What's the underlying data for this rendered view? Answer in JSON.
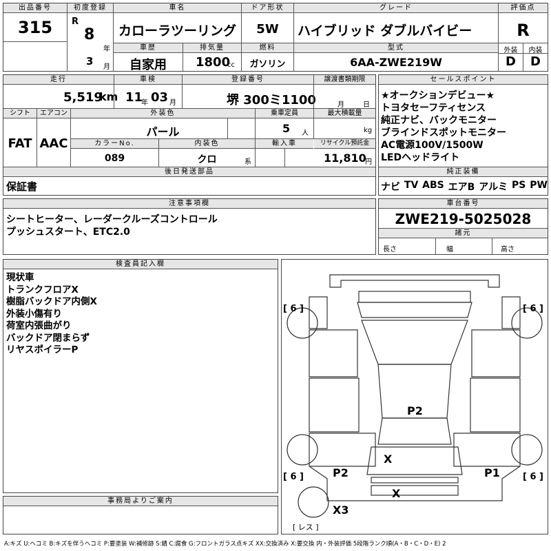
{
  "top": {
    "lot_label": "出品番号",
    "lot_no": "315",
    "first_reg_label": "初度登録",
    "era": "R",
    "year": "8",
    "year_unit": "年",
    "month": "3",
    "month_unit": "月",
    "model_label": "車名",
    "model": "カローラツーリング",
    "door_label": "ドア形状",
    "door": "5W",
    "grade_label": "グレード",
    "grade": "ハイブリッド ダブルバイビー",
    "score_label": "評価点",
    "score": "R",
    "history_label": "車歴",
    "history": "自家用",
    "disp_label": "排気量",
    "disp": "1800",
    "disp_unit": "cc",
    "fuel_label": "燃料",
    "fuel": "ガソリン",
    "type_label": "型式",
    "type": "6AA-ZWE219W",
    "ext_label": "外装",
    "ext": "D",
    "int_label": "内装",
    "int": "D"
  },
  "row2": {
    "mileage_label": "走行",
    "mileage": "5,519",
    "mileage_unit": "km",
    "inspect_label": "車検",
    "inspect_y": "11",
    "inspect_y_unit": "年",
    "inspect_m": "03",
    "inspect_m_unit": "月",
    "plate_label": "登録番号",
    "plate": "堺 300ミ1100",
    "transfer_label": "譲渡書類期限",
    "transfer_m": "月",
    "transfer_d": "日",
    "shift_label": "シフト",
    "shift": "FAT",
    "ac_label": "エアコン",
    "ac": "AAC",
    "color_label": "外装色",
    "color": "パール",
    "capacity_label": "乗車定員",
    "capacity": "5",
    "capacity_unit": "人",
    "load_label": "最大積載量",
    "load_unit": "kg",
    "colorno_label": "カラーNo.",
    "colorno": "089",
    "intcolor_label": "内装色",
    "intcolor": "クロ",
    "intcolor_unit": "系",
    "import_label": "輸入車",
    "recycle_label": "リサイクル預託金",
    "recycle": "11,810",
    "recycle_unit": "円",
    "later_label": "後日発送部品",
    "later": "保証書"
  },
  "sales": {
    "label": "セールスポイント",
    "items": [
      "★オークションデビュー★",
      "トヨタセーフティセンス",
      "純正ナビ、バックモニター",
      "ブラインドスポットモニター",
      "AC電源100V/1500W",
      "LEDヘッドライト"
    ]
  },
  "equip": {
    "label": "純正装備",
    "items": [
      "ナビ",
      "TV",
      "ABS",
      "エアB",
      "アルミ",
      "PS",
      "PW"
    ]
  },
  "notes": {
    "label": "注意事項欄",
    "lines": [
      "シートヒーター、レーダークルーズコントロール",
      "プッシュスタート、ETC2.0"
    ]
  },
  "chassis": {
    "label": "車台番号",
    "number": "ZWE219-5025028",
    "spec_label": "諸元",
    "length": "長さ",
    "width": "幅",
    "height": "高さ"
  },
  "inspector": {
    "label": "検査員記入欄",
    "lines": [
      "現状車",
      "トランクフロアX",
      "樹脂バックドア内側X",
      "外装小傷有り",
      "荷室内張曲がり",
      "バックドア閉まらず",
      "リヤスポイラーP"
    ]
  },
  "diagram": {
    "tire_fl": "[ 6 ]",
    "tire_fr": "[ 6 ]",
    "tire_rl": "[ 6 ]",
    "tire_rr": "[ 6 ]",
    "mark_roof": "P2",
    "mark_rear": "X",
    "mark_left": "P2",
    "mark_right": "P1",
    "mark_bumper": "X",
    "mark_spare": "X3",
    "spare_label": "[ レス ]"
  },
  "office": {
    "label": "事務局よりご案内"
  },
  "legend": "A:キズ U:ヘコミ B:キズを伴うヘコミ P:要塗装 W:補修跡 S:錆 C:腐食 G:フロントガラス点キズ XX:交換済み X:要交換 内・外装評価 5段階ランク順(A・B・C・D・E) 2"
}
